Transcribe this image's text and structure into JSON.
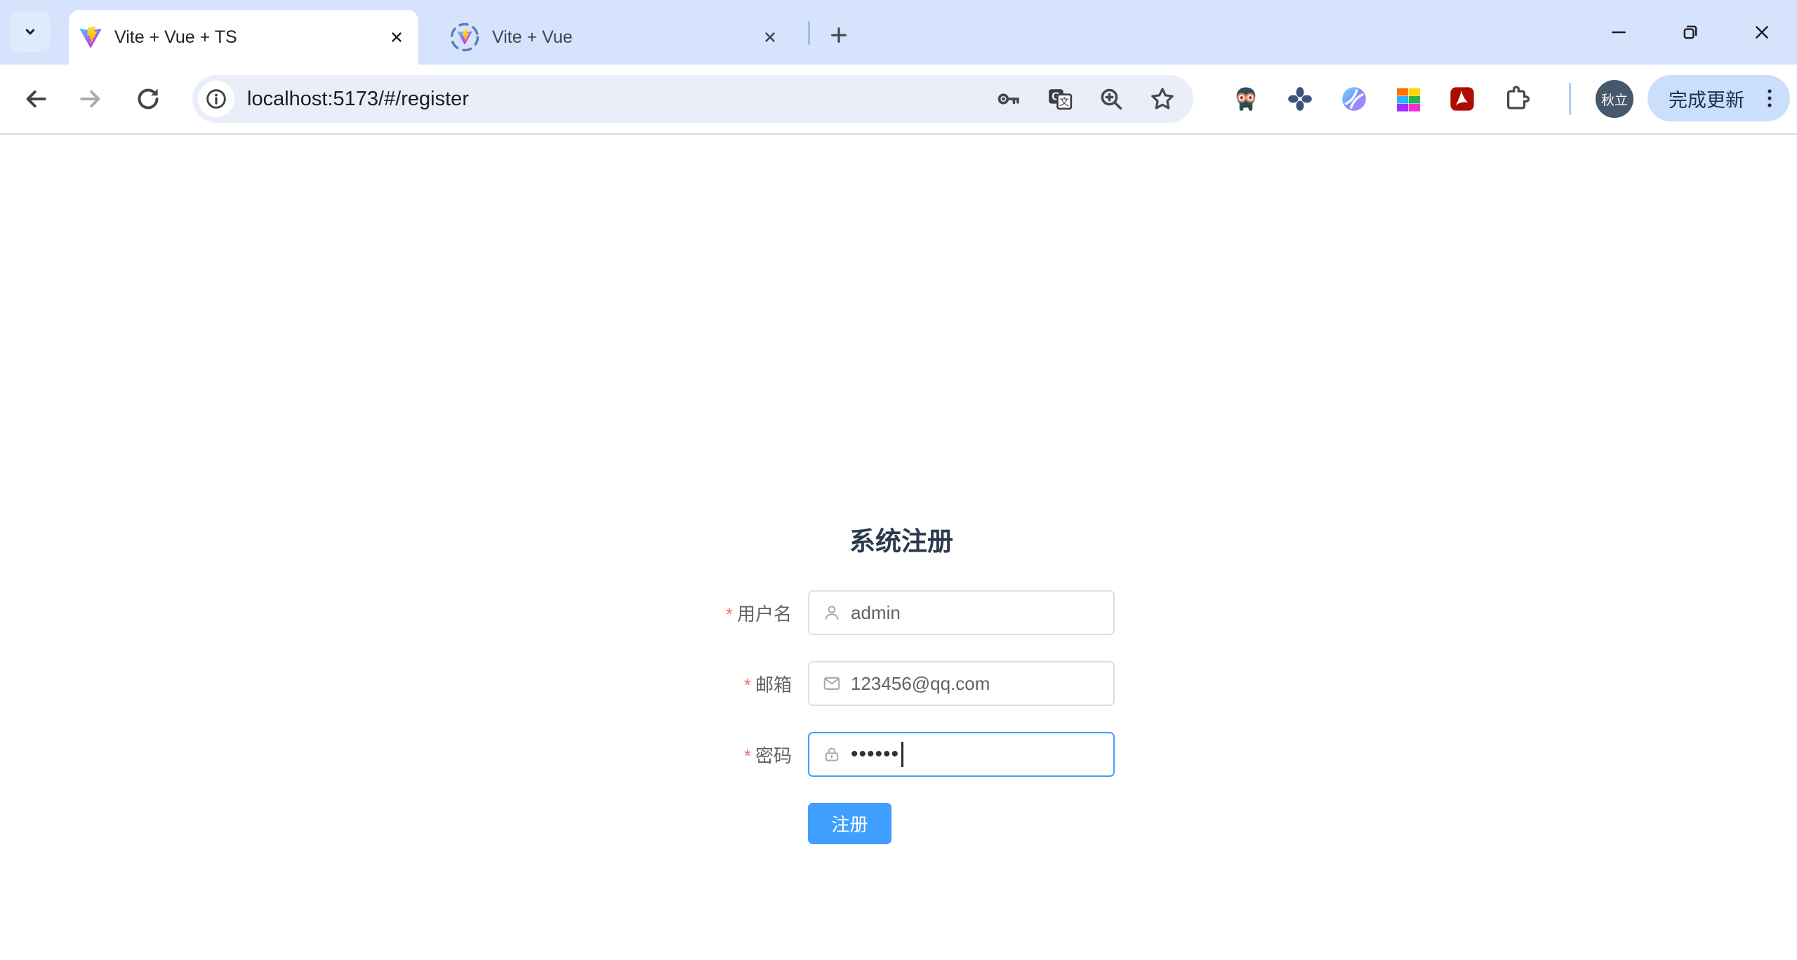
{
  "window": {
    "tabs": [
      {
        "title": "Vite + Vue + TS",
        "active": true
      },
      {
        "title": "Vite + Vue",
        "active": false
      }
    ]
  },
  "toolbar": {
    "url": "localhost:5173/#/register",
    "avatar_label": "秋立",
    "update_button_label": "完成更新"
  },
  "page": {
    "title": "系统注册",
    "form": {
      "required_mark": "*",
      "username": {
        "label": "用户名",
        "value": "admin"
      },
      "email": {
        "label": "邮箱",
        "value": "123456@qq.com"
      },
      "password": {
        "label": "密码",
        "masked_value": "••••••"
      },
      "submit_label": "注册"
    }
  },
  "icons": {
    "tab_search": "chevron-down",
    "vite_logo": "gradient V shield with lightning bolt",
    "tab_loading_ring": "dashed circle around favicon",
    "close": "x-cross",
    "new_tab": "plus",
    "minimize": "horizontal line",
    "restore": "overlapping squares",
    "back": "left arrow",
    "forward": "right arrow",
    "reload": "circular arrow",
    "site_info": "circled i",
    "password_key": "key",
    "translate": "G + 文 squares",
    "zoom_in": "magnifier with plus",
    "bookmark": "star outline",
    "ext_skull": "teal skull with orange glasses",
    "ext_clover": "dark blue four-petal clover",
    "ext_sphere": "purple-teal striped sphere",
    "ext_grid": "colorful 2x3 grid",
    "ext_acrobat": "red square with white loop",
    "extensions_puzzle": "puzzle piece outline",
    "menu_kebab": "three vertical dots",
    "user_field": "person outline",
    "email_field": "envelope outline",
    "password_field": "padlock outline"
  },
  "colors": {
    "tab_strip_bg": "#d5e3fc",
    "toolbar_bg": "#ffffff",
    "omnibox_bg": "#e9eef8",
    "update_pill_bg": "#cbdffc",
    "avatar_bg": "#46586b",
    "accent_primary": "#409eff",
    "focus_border": "#409eff",
    "input_border": "#dcdfe6",
    "required_red": "#f56c6c",
    "title_text": "#2b3b4e"
  }
}
